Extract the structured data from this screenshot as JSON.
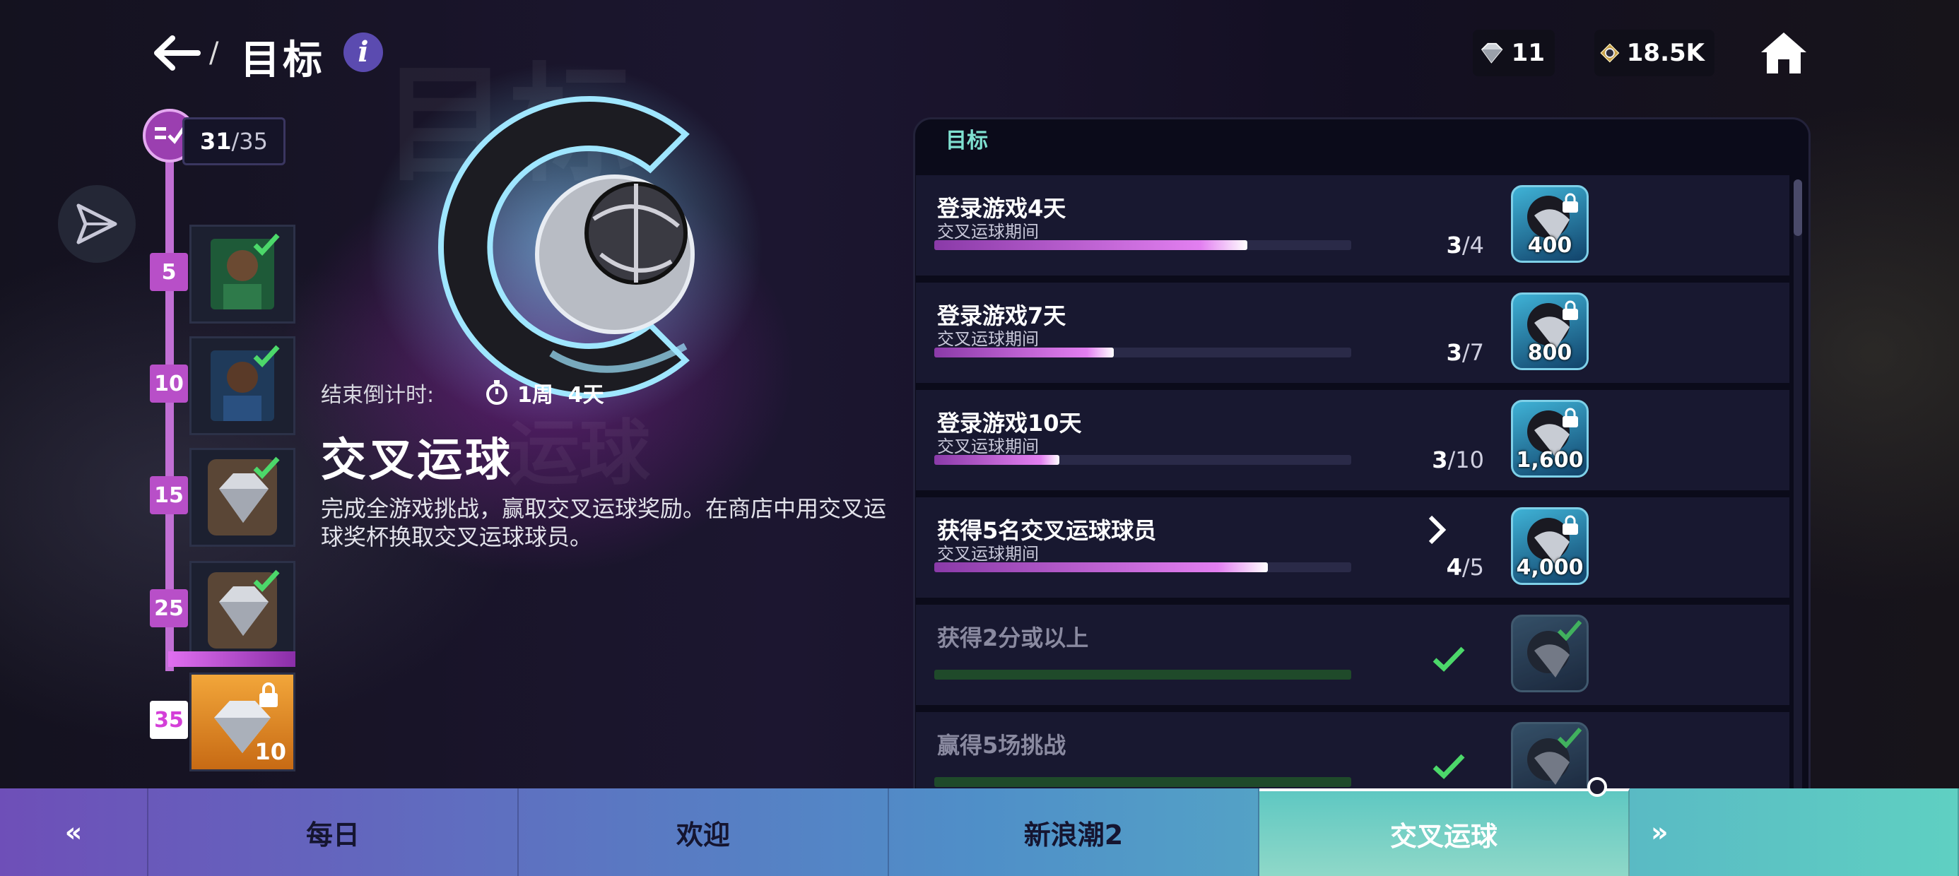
{
  "header": {
    "title": "目标",
    "separator": "/",
    "info_label": "i"
  },
  "currencies": {
    "gems": "11",
    "tokens": "18.5K"
  },
  "progress_track": {
    "current": "31",
    "total": "/35",
    "milestones": [
      {
        "level": "5",
        "reward": "player-card",
        "claimed": true
      },
      {
        "level": "10",
        "reward": "player-card",
        "claimed": true
      },
      {
        "level": "15",
        "reward": "diamond-gem",
        "claimed": true
      },
      {
        "level": "25",
        "reward": "diamond-gem",
        "claimed": true
      },
      {
        "level": "35",
        "reward": "diamond-gem",
        "amount": "10",
        "claimed": false
      }
    ]
  },
  "event": {
    "countdown_label": "结束倒计时:",
    "countdown_value": "1周  4天",
    "title": "交叉运球",
    "description": "完成全游戏挑战，赢取交叉运球奖励。在商店中用交叉运球奖杯换取交叉运球球员。",
    "watermark_1": "目标",
    "watermark_2": "运球"
  },
  "goals_panel": {
    "title": "目标",
    "goals": [
      {
        "name": "登录游戏4天",
        "period": "交叉运球期间",
        "progress": "3",
        "target": "/4",
        "fraction": 0.75,
        "reward": "400",
        "locked": true,
        "done": false
      },
      {
        "name": "登录游戏7天",
        "period": "交叉运球期间",
        "progress": "3",
        "target": "/7",
        "fraction": 0.43,
        "reward": "800",
        "locked": true,
        "done": false
      },
      {
        "name": "登录游戏10天",
        "period": "交叉运球期间",
        "progress": "3",
        "target": "/10",
        "fraction": 0.3,
        "reward": "1,600",
        "locked": true,
        "done": false
      },
      {
        "name": "获得5名交叉运球球员",
        "period": "交叉运球期间",
        "progress": "4",
        "target": "/5",
        "fraction": 0.8,
        "reward": "4,000",
        "locked": true,
        "done": false,
        "has_chevron": true
      },
      {
        "name": "获得2分或以上",
        "period": "",
        "progress": "",
        "target": "",
        "fraction": 1.0,
        "reward": "",
        "locked": false,
        "done": true
      },
      {
        "name": "赢得5场挑战",
        "period": "",
        "progress": "",
        "target": "",
        "fraction": 1.0,
        "reward": "",
        "locked": false,
        "done": true
      }
    ]
  },
  "tabs": [
    {
      "label": "«",
      "active": false
    },
    {
      "label": "每日",
      "active": false
    },
    {
      "label": "欢迎",
      "active": false
    },
    {
      "label": "新浪潮2",
      "active": false
    },
    {
      "label": "交叉运球",
      "active": true
    },
    {
      "label": "»",
      "active": false
    }
  ],
  "colors": {
    "accent_purple": "#b84fc8",
    "progress_pink": "#e27ff0",
    "done_green": "#4cd86a",
    "panel_title": "#7fe0d0"
  }
}
